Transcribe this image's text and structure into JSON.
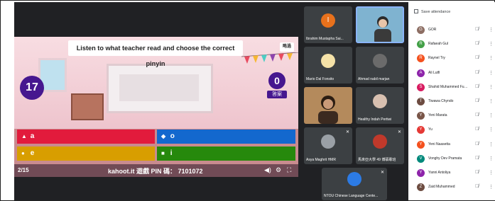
{
  "kahoot": {
    "question": "Listen to what teacher read and choose the correct pinyin",
    "skip_label": "略過",
    "timer": "17",
    "answer_count": "0",
    "answer_label": "答案",
    "answers": [
      {
        "symbol": "▲",
        "text": "a",
        "color": "#e21b3c"
      },
      {
        "symbol": "◆",
        "text": "o",
        "color": "#1368ce"
      },
      {
        "symbol": "●",
        "text": "e",
        "color": "#d89e00"
      },
      {
        "symbol": "■",
        "text": "i",
        "color": "#26890c"
      }
    ],
    "page": "2/15",
    "pin_text": "kahoot.it 遊戲 PIN 碼： 7101072",
    "controls": [
      "◀)",
      "⚙",
      "⛶"
    ]
  },
  "tiles": [
    {
      "name": "Ibrahim Mustapha Sai...",
      "initial": "I",
      "color": "#e8711c"
    },
    {
      "name": "",
      "initial": "",
      "color": "#4a90b8"
    },
    {
      "name": "Mario Dal Fonsito",
      "initial": "",
      "color": "#c9b27a"
    },
    {
      "name": "Ahmad nabil marjan",
      "initial": "",
      "color": "#6b6b6b"
    },
    {
      "name": "",
      "initial": "",
      "color": "#8a6a4a"
    },
    {
      "name": "Healthy Indah Pertiwi",
      "initial": "",
      "color": "#d8c0b0"
    },
    {
      "name": "Asya Maghrit HMR",
      "initial": "",
      "color": "#9aa0a6"
    },
    {
      "name": "馬來亞大學 49 博碩專班",
      "initial": "",
      "color": "#c0392b"
    },
    {
      "name": "NTOU Chinese Language Cente...",
      "initial": "",
      "color": "#2c7be5"
    }
  ],
  "panel": {
    "save_label": "Save attendance",
    "participants": [
      {
        "name": "GOR",
        "initial": "G",
        "color": "#8d6e63"
      },
      {
        "name": "Rafaeah Gul",
        "initial": "R",
        "color": "#43a047"
      },
      {
        "name": "Raynel Try",
        "initial": "R",
        "color": "#f4511e"
      },
      {
        "name": "Ali Lutfi",
        "initial": "A",
        "color": "#8e24aa"
      },
      {
        "name": "Shahid Muhammed Furq...",
        "initial": "S",
        "color": "#d81b60"
      },
      {
        "name": "Tiwawa Chyndo",
        "initial": "T",
        "color": "#6d4c41"
      },
      {
        "name": "Yeni Marata",
        "initial": "Y",
        "color": "#795548"
      },
      {
        "name": "Yu",
        "initial": "Y",
        "color": "#e53935"
      },
      {
        "name": "Yeni Naasetta",
        "initial": "Y",
        "color": "#f4511e"
      },
      {
        "name": "Vonghy Dev Pramata",
        "initial": "V",
        "color": "#00897b"
      },
      {
        "name": "Yanni Antoliya",
        "initial": "Y",
        "color": "#8e24aa"
      },
      {
        "name": "Zaid Muhammed",
        "initial": "Z",
        "color": "#6d4c41"
      }
    ]
  },
  "colors": {
    "kahoot_purple": "#46178f",
    "meet_bg": "#202124"
  }
}
